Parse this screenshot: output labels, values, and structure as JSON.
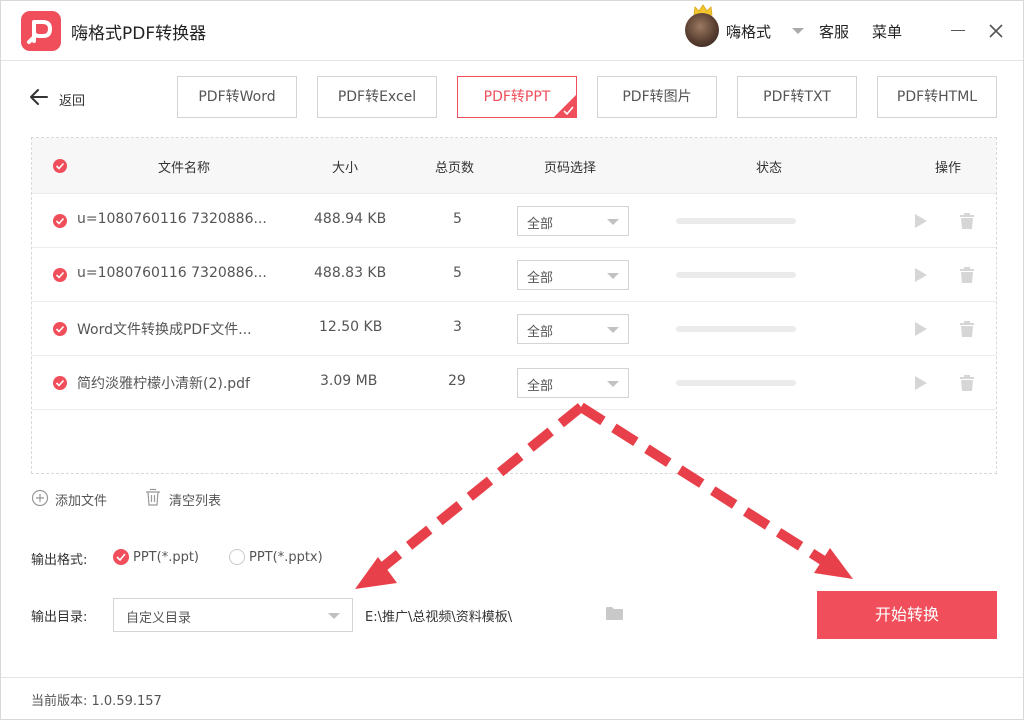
{
  "app": {
    "title": "嗨格式PDF转换器",
    "username": "嗨格式",
    "service_label": "客服",
    "menu_label": "菜单"
  },
  "toolbar": {
    "back_label": "返回",
    "tabs": [
      {
        "label": "PDF转Word",
        "active": false
      },
      {
        "label": "PDF转Excel",
        "active": false
      },
      {
        "label": "PDF转PPT",
        "active": true
      },
      {
        "label": "PDF转图片",
        "active": false
      },
      {
        "label": "PDF转TXT",
        "active": false
      },
      {
        "label": "PDF转HTML",
        "active": false
      }
    ]
  },
  "table": {
    "headers": {
      "name": "文件名称",
      "size": "大小",
      "pages": "总页数",
      "range": "页码选择",
      "status": "状态",
      "action": "操作"
    },
    "rows": [
      {
        "name": "u=1080760116 7320886...",
        "size": "488.94 KB",
        "pages": "5",
        "range": "全部",
        "progress": 0
      },
      {
        "name": "u=1080760116 7320886...",
        "size": "488.83 KB",
        "pages": "5",
        "range": "全部",
        "progress": 0
      },
      {
        "name": "Word文件转换成PDF文件...",
        "size": "12.50 KB",
        "pages": "3",
        "range": "全部",
        "progress": 0
      },
      {
        "name": "简约淡雅柠檬小清新(2).pdf",
        "size": "3.09 MB",
        "pages": "29",
        "range": "全部",
        "progress": 0
      }
    ]
  },
  "actions": {
    "add_file": "添加文件",
    "clear_list": "清空列表"
  },
  "output": {
    "format_label": "输出格式:",
    "formats": [
      {
        "label": "PPT(*.ppt)",
        "selected": true
      },
      {
        "label": "PPT(*.pptx)",
        "selected": false
      }
    ],
    "dir_label": "输出目录:",
    "dir_select": "自定义目录",
    "dir_path": "E:\\推广\\总视频\\资料模板\\"
  },
  "start_label": "开始转换",
  "footer": {
    "version_label": "当前版本: 1.0.59.157"
  },
  "colors": {
    "accent": "#ef4e5a",
    "annotation": "#e8404a"
  },
  "icons": [
    "pdf-logo-icon",
    "crown-icon",
    "chevron-down-icon",
    "close-icon",
    "back-arrow-icon",
    "check-icon",
    "play-icon",
    "trash-icon",
    "plus-circle-icon",
    "folder-icon"
  ]
}
